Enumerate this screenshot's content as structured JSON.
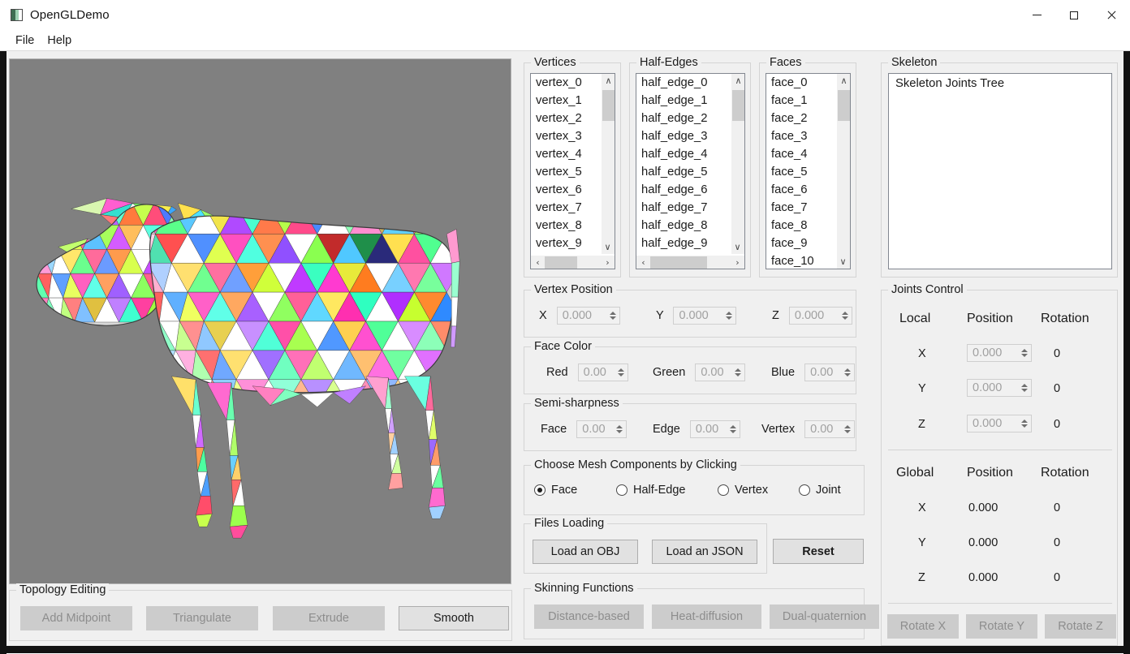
{
  "window": {
    "title": "OpenGLDemo",
    "icon": "app-icon",
    "minimize": "—",
    "maximize": "□",
    "close": "✕"
  },
  "menubar": {
    "items": [
      {
        "label": "File"
      },
      {
        "label": "Help"
      }
    ]
  },
  "viewport": {
    "background_color": "#808080",
    "model": "triangulated-cow-mesh"
  },
  "vertices_panel": {
    "title": "Vertices",
    "items": [
      "vertex_0",
      "vertex_1",
      "vertex_2",
      "vertex_3",
      "vertex_4",
      "vertex_5",
      "vertex_6",
      "vertex_7",
      "vertex_8",
      "vertex_9"
    ],
    "scroll_up": "∧",
    "scroll_down": "∨",
    "scroll_left": "‹",
    "scroll_right": "›"
  },
  "halfedges_panel": {
    "title": "Half-Edges",
    "items": [
      "half_edge_0",
      "half_edge_1",
      "half_edge_2",
      "half_edge_3",
      "half_edge_4",
      "half_edge_5",
      "half_edge_6",
      "half_edge_7",
      "half_edge_8",
      "half_edge_9"
    ],
    "scroll_up": "∧",
    "scroll_down": "∨",
    "scroll_left": "‹",
    "scroll_right": "›"
  },
  "faces_panel": {
    "title": "Faces",
    "items": [
      "face_0",
      "face_1",
      "face_2",
      "face_3",
      "face_4",
      "face_5",
      "face_6",
      "face_7",
      "face_8",
      "face_9",
      "face_10"
    ],
    "scroll_up": "∧",
    "scroll_down": "∨"
  },
  "skeleton_panel": {
    "title": "Skeleton",
    "tree_root": "Skeleton Joints Tree"
  },
  "vertex_position": {
    "title": "Vertex Position",
    "fields": [
      {
        "label": "X",
        "value": "0.000"
      },
      {
        "label": "Y",
        "value": "0.000"
      },
      {
        "label": "Z",
        "value": "0.000"
      }
    ]
  },
  "face_color": {
    "title": "Face Color",
    "fields": [
      {
        "label": "Red",
        "value": "0.00"
      },
      {
        "label": "Green",
        "value": "0.00"
      },
      {
        "label": "Blue",
        "value": "0.00"
      }
    ]
  },
  "semi_sharpness": {
    "title": "Semi-sharpness",
    "fields": [
      {
        "label": "Face",
        "value": "0.00"
      },
      {
        "label": "Edge",
        "value": "0.00"
      },
      {
        "label": "Vertex",
        "value": "0.00"
      }
    ]
  },
  "choose_components": {
    "title": "Choose Mesh Components by Clicking",
    "options": [
      {
        "label": "Face",
        "selected": true
      },
      {
        "label": "Half-Edge",
        "selected": false
      },
      {
        "label": "Vertex",
        "selected": false
      },
      {
        "label": "Joint",
        "selected": false
      }
    ]
  },
  "files_loading": {
    "title": "Files Loading",
    "buttons": [
      {
        "label": "Load an OBJ",
        "disabled": false
      },
      {
        "label": "Load an JSON",
        "disabled": false
      }
    ]
  },
  "reset_button": {
    "label": "Reset",
    "disabled": false,
    "bold": true
  },
  "topology_editing": {
    "title": "Topology Editing",
    "buttons": [
      {
        "label": "Add Midpoint",
        "disabled": true
      },
      {
        "label": "Triangulate",
        "disabled": true
      },
      {
        "label": "Extrude",
        "disabled": true
      },
      {
        "label": "Smooth",
        "disabled": false
      }
    ]
  },
  "skinning_functions": {
    "title": "Skinning Functions",
    "buttons": [
      {
        "label": "Distance-based",
        "disabled": true
      },
      {
        "label": "Heat-diffusion",
        "disabled": true
      },
      {
        "label": "Dual-quaternion",
        "disabled": true
      }
    ]
  },
  "joints_control": {
    "title": "Joints Control",
    "local": {
      "scope_label": "Local",
      "position_label": "Position",
      "rotation_label": "Rotation",
      "rows": [
        {
          "axis": "X",
          "position": "0.000",
          "rotation": "0"
        },
        {
          "axis": "Y",
          "position": "0.000",
          "rotation": "0"
        },
        {
          "axis": "Z",
          "position": "0.000",
          "rotation": "0"
        }
      ]
    },
    "global": {
      "scope_label": "Global",
      "position_label": "Position",
      "rotation_label": "Rotation",
      "rows": [
        {
          "axis": "X",
          "position": "0.000",
          "rotation": "0"
        },
        {
          "axis": "Y",
          "position": "0.000",
          "rotation": "0"
        },
        {
          "axis": "Z",
          "position": "0.000",
          "rotation": "0"
        }
      ]
    },
    "rotate_buttons": [
      {
        "label": "Rotate X",
        "disabled": true
      },
      {
        "label": "Rotate Y",
        "disabled": true
      },
      {
        "label": "Rotate Z",
        "disabled": true
      }
    ]
  },
  "colors": {
    "window_bg": "#f0f0f0",
    "viewport_bg": "#808080",
    "frame": "#121212",
    "groupbox_border": "#d4d4d4",
    "button_bg": "#e1e1e1",
    "button_disabled_bg": "#cccccc",
    "text": "#1b1b1b",
    "disabled_text": "#a0a0a0"
  }
}
